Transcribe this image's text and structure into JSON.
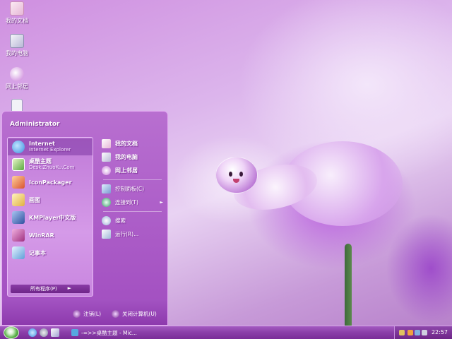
{
  "desktop": {
    "icons": [
      {
        "label": "我的文档",
        "icon": "folder-icon"
      },
      {
        "label": "我的电脑",
        "icon": "computer-icon"
      },
      {
        "label": "网上邻居",
        "icon": "network-icon"
      },
      {
        "label": "",
        "icon": "document-icon"
      }
    ]
  },
  "start_menu": {
    "user": "Administrator",
    "programs": [
      {
        "title": "Internet",
        "subtitle": "Internet Explorer",
        "icon": "internet-explorer-icon",
        "color": "#3c8fe0"
      },
      {
        "title": "桌酷主题",
        "subtitle": "Desk.ZhuoKu.Com",
        "icon": "theme-icon",
        "color": "#5aa840"
      },
      {
        "title": "IconPackager",
        "subtitle": "",
        "icon": "iconpackager-icon",
        "color": "#d9532f"
      },
      {
        "title": "画图",
        "subtitle": "",
        "icon": "paint-icon",
        "color": "#e0b040"
      },
      {
        "title": "KMPlayer中文版",
        "subtitle": "",
        "icon": "kmplayer-icon",
        "color": "#3050a0"
      },
      {
        "title": "WinRAR",
        "subtitle": "",
        "icon": "winrar-icon",
        "color": "#a03080"
      },
      {
        "title": "记事本",
        "subtitle": "",
        "icon": "notepad-icon",
        "color": "#5f9fd8"
      }
    ],
    "all_programs": "所有程序(P)",
    "places": [
      {
        "label": "我的文档",
        "icon": "folder-icon"
      },
      {
        "label": "我的电脑",
        "icon": "computer-icon"
      },
      {
        "label": "网上邻居",
        "icon": "network-icon"
      }
    ],
    "system": [
      {
        "label": "控制面板(C)",
        "icon": "control-panel-icon"
      },
      {
        "label": "连接到(T)",
        "icon": "connect-icon"
      }
    ],
    "tools": [
      {
        "label": "搜索",
        "icon": "search-icon"
      },
      {
        "label": "运行(R)...",
        "icon": "run-icon"
      }
    ],
    "logoff": "注销(L)",
    "shutdown": "关闭计算机(U)"
  },
  "taskbar": {
    "task_label": "-=>>桌酷主题 - Mic...",
    "clock": "22:57"
  },
  "colors": {
    "accent": "#9a45b8",
    "menu_light": "#d59ae8"
  }
}
